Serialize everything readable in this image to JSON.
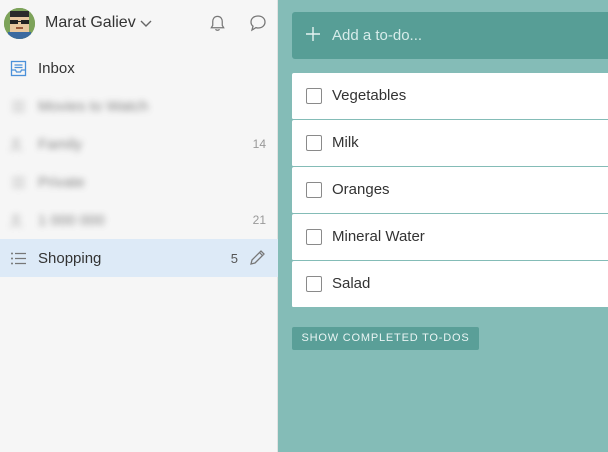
{
  "user": {
    "name": "Marat Galiev"
  },
  "icons": {
    "avatar": "avatar-icon",
    "caret": "chevron-down-icon",
    "notifications": "bell-icon",
    "messages": "chat-bubble-icon",
    "add": "plus-icon",
    "edit": "pencil-icon"
  },
  "sidebar": {
    "items": [
      {
        "label": "Inbox",
        "count": "",
        "icon": "inbox-icon",
        "blurred": false,
        "active": false
      },
      {
        "label": "Movies to Watch",
        "count": "",
        "icon": "list-icon",
        "blurred": true,
        "active": false
      },
      {
        "label": "Family",
        "count": "14",
        "icon": "shared-list-icon",
        "blurred": true,
        "active": false
      },
      {
        "label": "Private",
        "count": "",
        "icon": "list-icon",
        "blurred": true,
        "active": false
      },
      {
        "label": "1 000 000",
        "count": "21",
        "icon": "shared-list-icon",
        "blurred": true,
        "active": false
      },
      {
        "label": "Shopping",
        "count": "5",
        "icon": "list-icon",
        "blurred": false,
        "active": true
      }
    ]
  },
  "main": {
    "add_placeholder": "Add a to-do...",
    "tasks": [
      {
        "title": "Vegetables",
        "completed": false
      },
      {
        "title": "Milk",
        "completed": false
      },
      {
        "title": "Oranges",
        "completed": false
      },
      {
        "title": "Mineral Water",
        "completed": false
      },
      {
        "title": "Salad",
        "completed": false
      }
    ],
    "show_completed_label": "SHOW COMPLETED TO-DOS"
  },
  "colors": {
    "background": "#84bcb7",
    "add_bar": "#579e96",
    "sidebar": "#f6f6f6",
    "active_item": "#ddeaf7",
    "inbox_icon": "#4a90d9"
  }
}
